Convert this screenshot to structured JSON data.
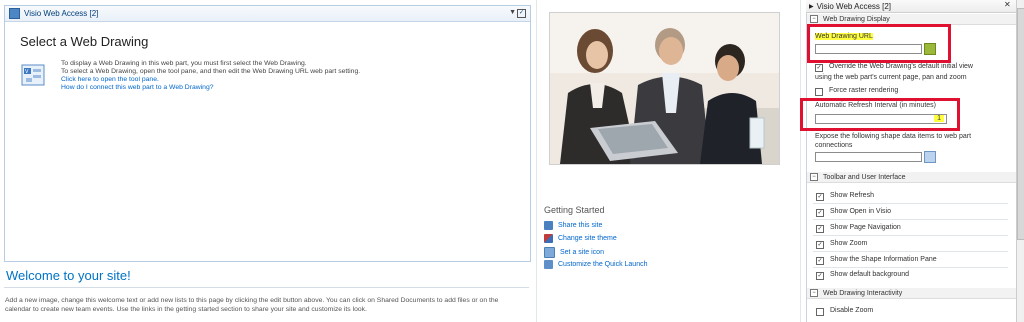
{
  "webpart": {
    "title": "Visio Web Access [2]",
    "heading": "Select a Web Drawing",
    "line1": "To display a Web Drawing in this web part, you must first select the Web Drawing.",
    "line2": "To select a Web Drawing, open the tool pane, and then edit the Web Drawing URL web part setting.",
    "link1": "Click here to open the tool pane.",
    "link2": "How do I connect this web part to a Web Drawing?"
  },
  "welcome": {
    "title": "Welcome to your site!",
    "body": "Add a new image, change this welcome text or add new lists to this page by clicking the edit button above. You can click on Shared Documents to add files or on the calendar to create new team events. Use the links in the getting started section to share your site and customize its look."
  },
  "getting_started": {
    "title": "Getting Started",
    "items": [
      {
        "label": "Share this site",
        "icon": "share-icon"
      },
      {
        "label": "Change site theme",
        "icon": "theme-icon"
      },
      {
        "label": "Set a site icon",
        "icon": "site-icon"
      },
      {
        "label": "Customize the Quick Launch",
        "icon": "quicklaunch-icon"
      }
    ]
  },
  "tool_pane": {
    "title": "Visio Web Access [2]",
    "section1": "Web Drawing Display",
    "url_label": "Web Drawing URL",
    "override_label_1": "Override the Web Drawing's default initial view",
    "override_label_2": "using the web part's current page, pan and zoom",
    "force_raster": "Force raster rendering",
    "refresh_label": "Automatic Refresh Interval (in minutes)",
    "refresh_value": "1",
    "expose_label_1": "Expose the following shape data items to web part",
    "expose_label_2": "connections",
    "section2": "Toolbar and User Interface",
    "toolbar_options": [
      "Show Refresh",
      "Show Open in Visio",
      "Show Page Navigation",
      "Show Zoom",
      "Show the Shape Information Pane",
      "Show default background"
    ],
    "section3": "Web Drawing Interactivity",
    "disable_zoom": "Disable Zoom"
  },
  "colors": {
    "link": "#0066cc",
    "highlight": "#ffff40",
    "annotation": "#e01030"
  }
}
